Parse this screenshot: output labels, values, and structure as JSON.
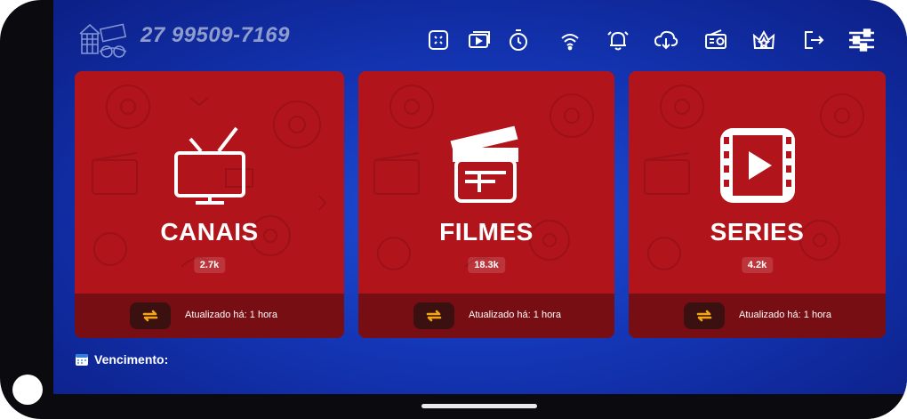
{
  "header": {
    "phone": "27 99509-7169"
  },
  "toolbar": {
    "icons": [
      "multiscreen-icon",
      "recordings-icon",
      "timer-icon",
      "wifi-icon",
      "alarm-icon",
      "download-icon",
      "radio-icon",
      "favorites-icon",
      "logout-icon",
      "settings-sliders-icon"
    ]
  },
  "cards": [
    {
      "title": "CANAIS",
      "count": "2.7k",
      "updated": "Atualizado há: 1 hora",
      "icon": "tv-icon"
    },
    {
      "title": "FILMES",
      "count": "18.3k",
      "updated": "Atualizado há: 1 hora",
      "icon": "clapperboard-icon"
    },
    {
      "title": "SERIES",
      "count": "4.2k",
      "updated": "Atualizado há: 1 hora",
      "icon": "play-film-icon"
    }
  ],
  "footer": {
    "expiry_label": "Vencimento:"
  },
  "colors": {
    "background_blue": "#1436b6",
    "card_red": "#b2141b",
    "refresh_orange": "#f2a516"
  }
}
